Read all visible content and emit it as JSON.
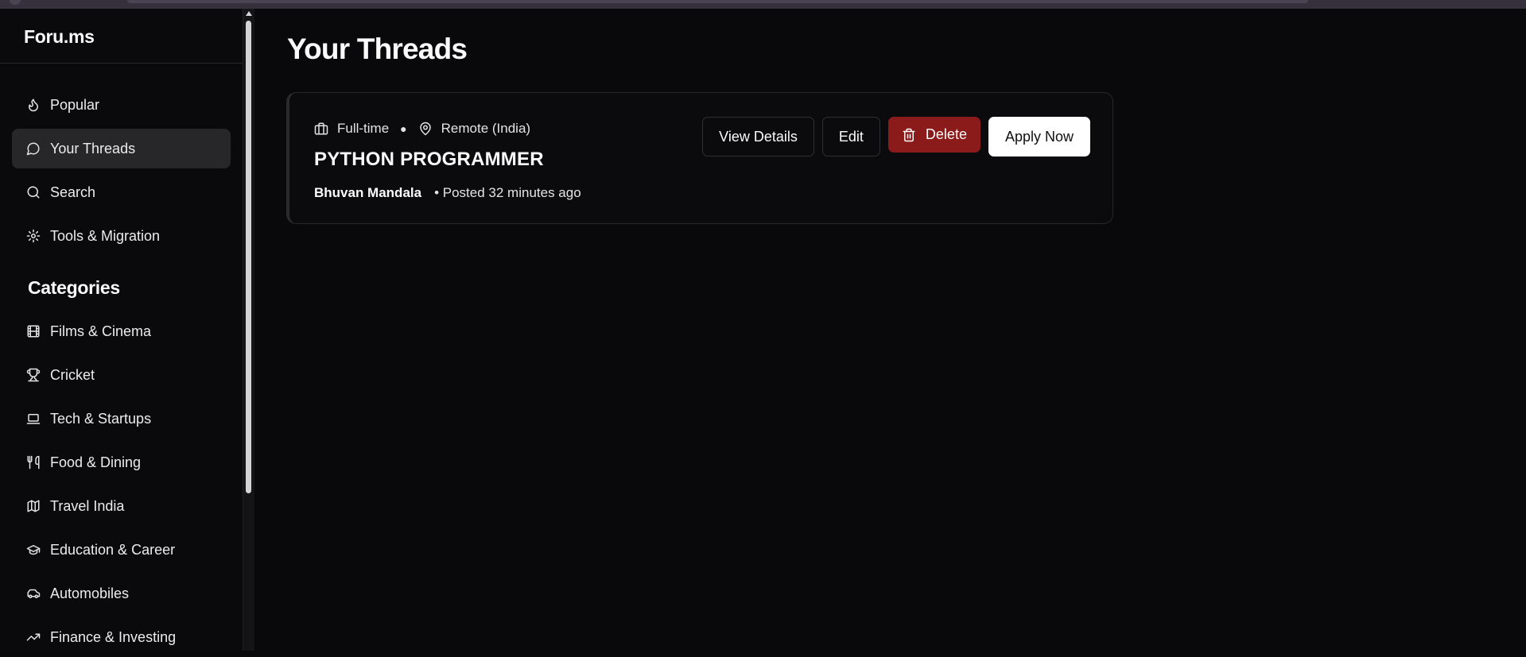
{
  "brand": "Foru.ms",
  "nav": [
    {
      "label": "Popular",
      "icon": "flame-icon",
      "active": false
    },
    {
      "label": "Your Threads",
      "icon": "message-circle-icon",
      "active": true
    },
    {
      "label": "Search",
      "icon": "search-icon",
      "active": false
    },
    {
      "label": "Tools & Migration",
      "icon": "gear-icon",
      "active": false
    }
  ],
  "categories_heading": "Categories",
  "categories": [
    {
      "label": "Films & Cinema",
      "icon": "film-icon"
    },
    {
      "label": "Cricket",
      "icon": "trophy-icon"
    },
    {
      "label": "Tech & Startups",
      "icon": "laptop-icon"
    },
    {
      "label": "Food & Dining",
      "icon": "utensils-icon"
    },
    {
      "label": "Travel India",
      "icon": "map-icon"
    },
    {
      "label": "Education & Career",
      "icon": "graduation-cap-icon"
    },
    {
      "label": "Automobiles",
      "icon": "car-icon"
    },
    {
      "label": "Finance & Investing",
      "icon": "trending-up-icon"
    }
  ],
  "page_title": "Your Threads",
  "thread": {
    "job_type": "Full-time",
    "location": "Remote (India)",
    "title": "PYTHON PROGRAMMER",
    "author": "Bhuvan Mandala",
    "posted": "• Posted 32 minutes ago",
    "actions": {
      "view": "View Details",
      "edit": "Edit",
      "delete": "Delete",
      "apply": "Apply Now"
    }
  },
  "colors": {
    "background": "#09090b",
    "delete": "#8b1a1a",
    "active_nav": "#27272a"
  }
}
